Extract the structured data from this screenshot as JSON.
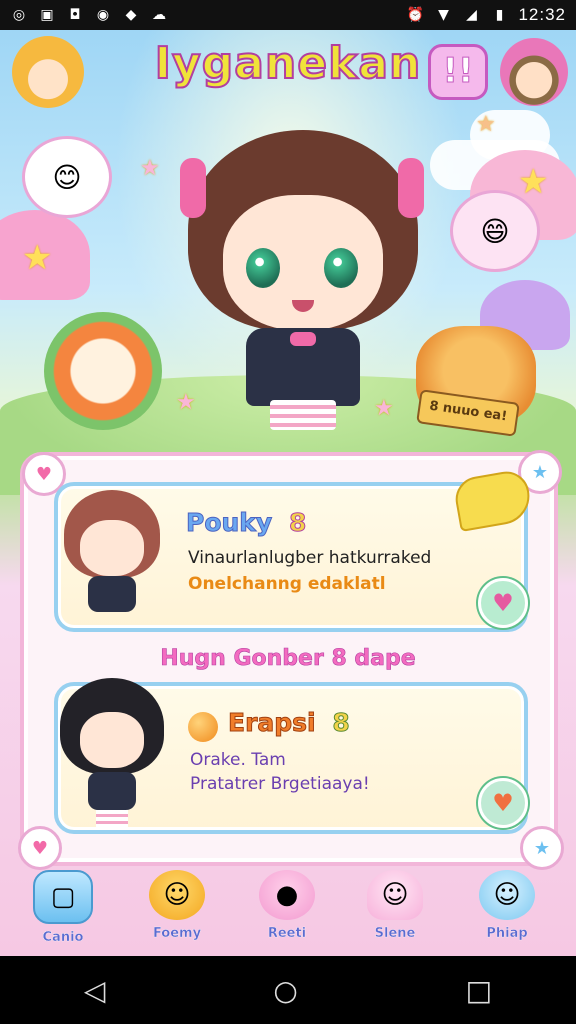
{
  "status_bar": {
    "time": "12:32",
    "left_icons": [
      "whatsapp-icon",
      "instagram-icon",
      "messenger-icon",
      "chrome-icon",
      "dropbox-icon",
      "cloud-icon"
    ],
    "right_icons": [
      "alarm-icon",
      "wifi-icon",
      "signal-icon",
      "battery-icon"
    ]
  },
  "game": {
    "title": "Iyganekan",
    "title_badge": "!!"
  },
  "cards": [
    {
      "name": "Pouky",
      "level": "8",
      "line1": "Vinaurlanlugber hatkurraked",
      "line2": "Onelchanng edaklatl"
    },
    {
      "name": "Erapsi",
      "level": "8",
      "line1": "Orake. Tam",
      "line2": "Pratatrer Brgetiaaya!"
    }
  ],
  "section_header": "Hugn Gonber 8 dape",
  "bottom_nav": [
    {
      "label": "Canio",
      "icon": "ice-cube-icon"
    },
    {
      "label": "Foemy",
      "icon": "mascot-icon"
    },
    {
      "label": "Reeti",
      "icon": "sweet-icon"
    },
    {
      "label": "Slene",
      "icon": "ghost-icon"
    },
    {
      "label": "Phiap",
      "icon": "blob-icon"
    }
  ],
  "sign_text": "8 nuuo ea!",
  "colors": {
    "title_fill": "#f0e33a",
    "title_stroke": "#b23fa0",
    "panel_border": "#f2b6d9",
    "card_border": "#97d0f0",
    "card_name": "#6aa8f0",
    "section_header": "#f36bc0"
  }
}
